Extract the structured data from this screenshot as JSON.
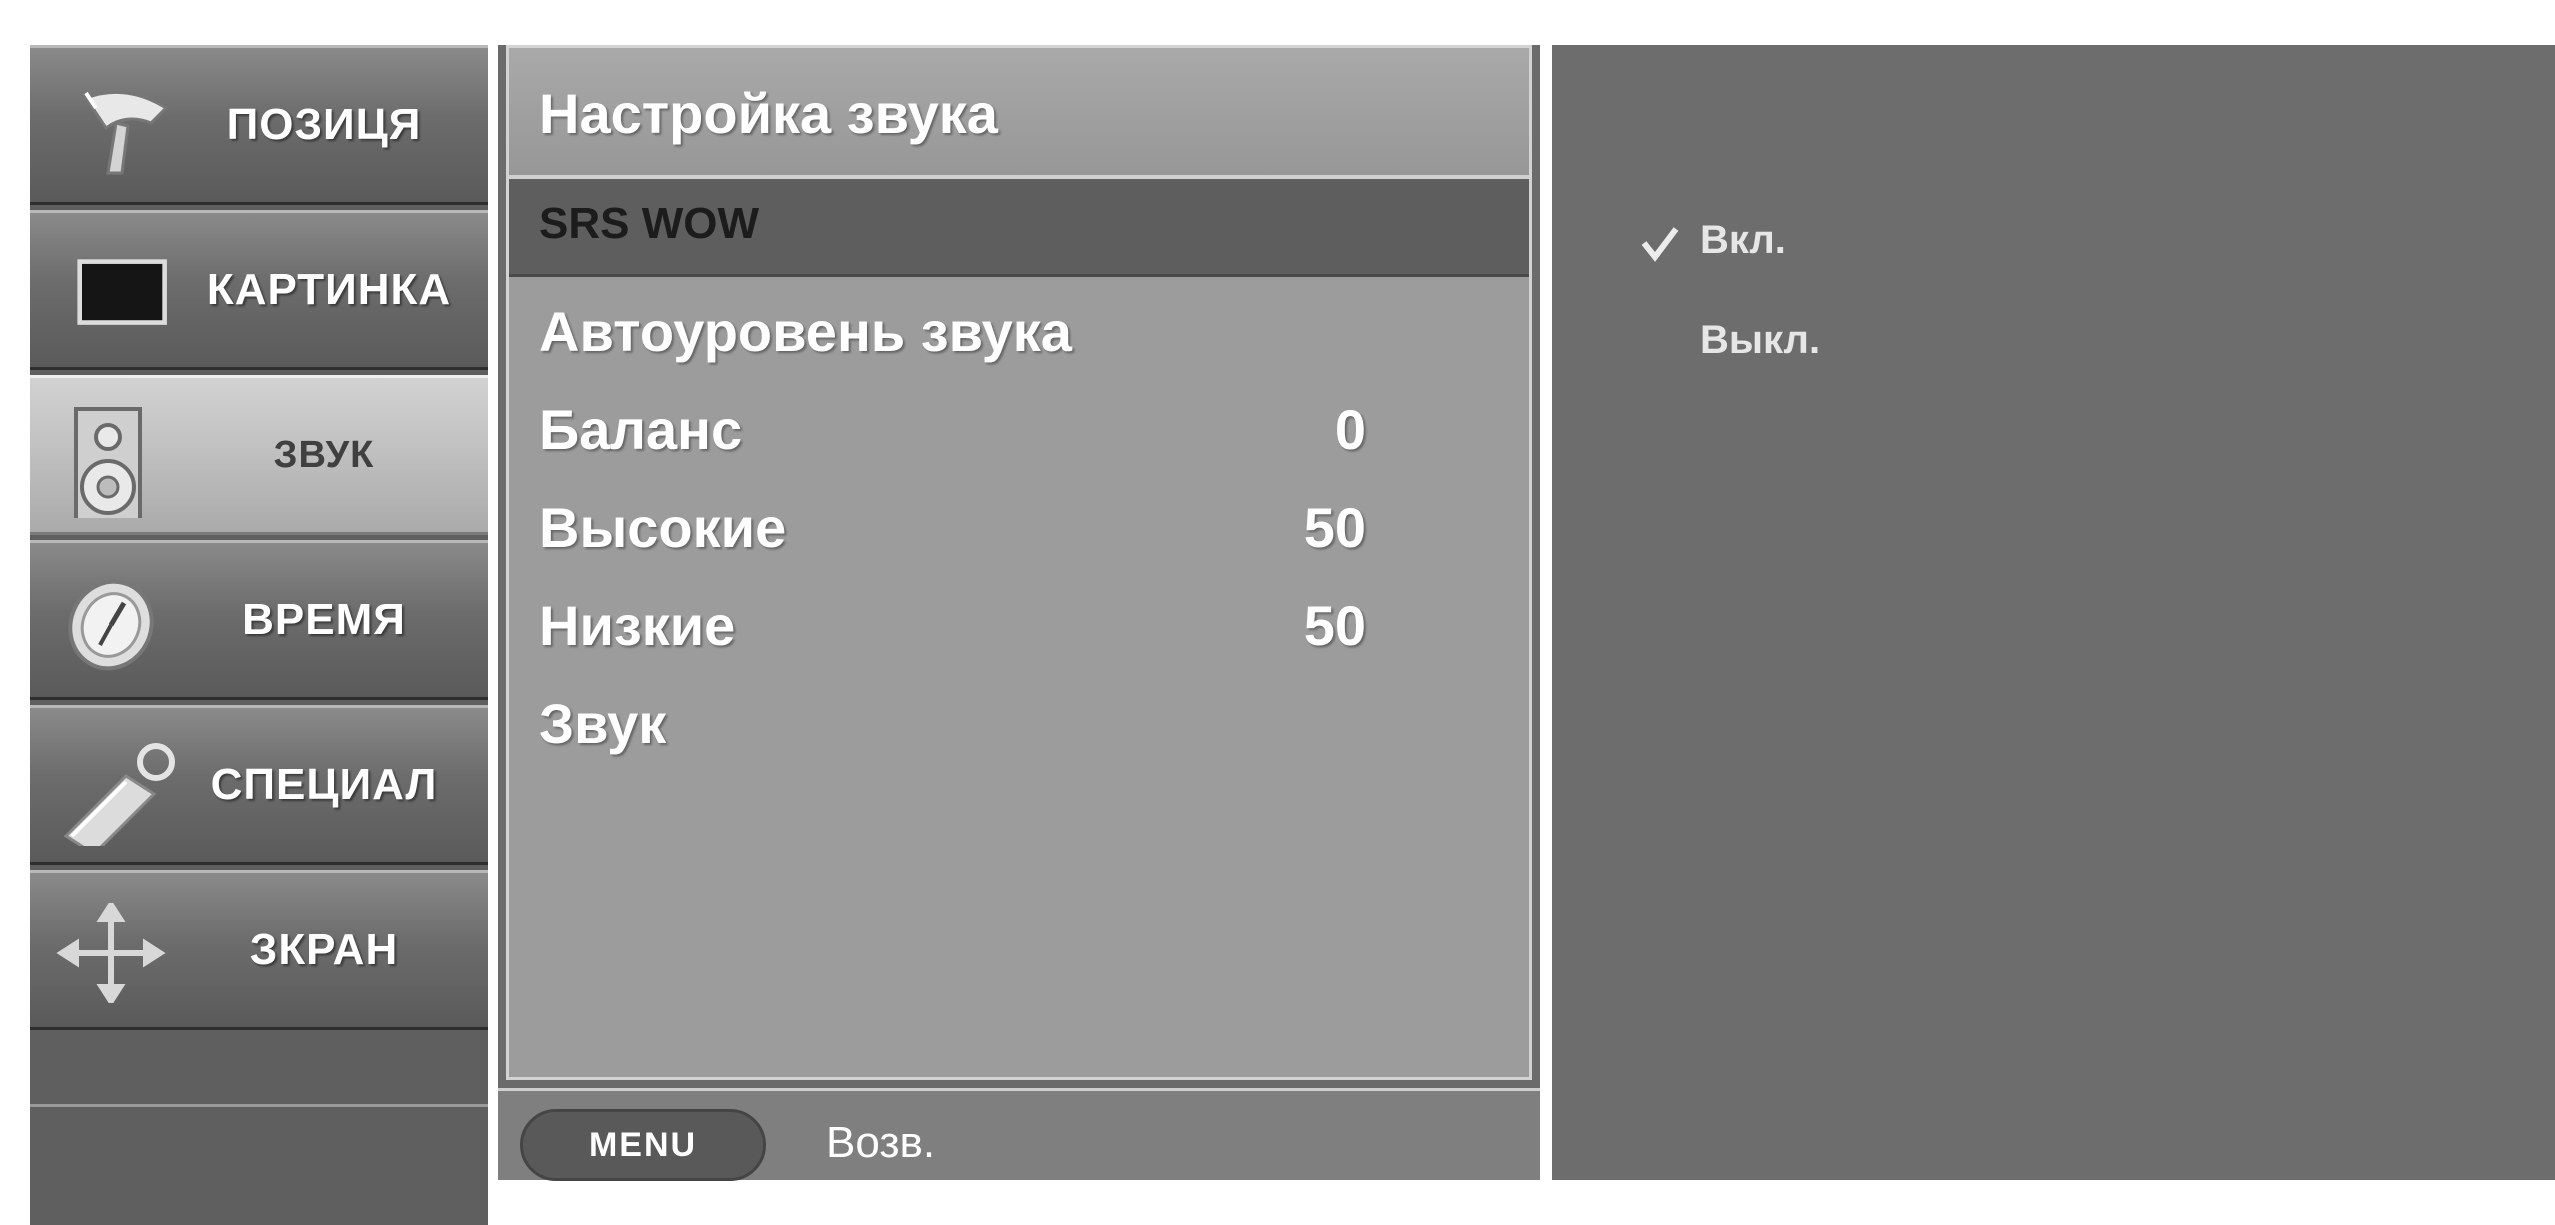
{
  "sidebar": {
    "items": [
      {
        "label": "ПОЗИЦЯ",
        "icon": "satellite-dish-icon",
        "active": false
      },
      {
        "label": "КАРТИНКА",
        "icon": "tv-screen-icon",
        "active": false
      },
      {
        "label": "ЗВУК",
        "icon": "speaker-icon",
        "active": true
      },
      {
        "label": "ВРЕМЯ",
        "icon": "clock-icon",
        "active": false
      },
      {
        "label": "СПЕЦИАЛ",
        "icon": "key-tag-icon",
        "active": false
      },
      {
        "label": "ЗКРАН",
        "icon": "move-arrows-icon",
        "active": false
      }
    ]
  },
  "menu": {
    "title": "Настройка звука",
    "items": [
      {
        "label": "SRS WOW",
        "value": "",
        "selected": true
      },
      {
        "label": "Автоуровень звука",
        "value": ""
      },
      {
        "label": "Баланс",
        "value": "0"
      },
      {
        "label": "Высокие",
        "value": "50"
      },
      {
        "label": "Низкие",
        "value": "50"
      },
      {
        "label": "Звук",
        "value": ""
      }
    ],
    "footer": {
      "menu_button": "MENU",
      "back_label": "Возв."
    }
  },
  "options": {
    "items": [
      {
        "label": "Вкл.",
        "checked": true
      },
      {
        "label": "Выкл.",
        "checked": false
      }
    ]
  },
  "colors": {
    "panel_dark": "#6d6d6d",
    "panel_mid": "#9c9c9c",
    "selected_row": "#5e5e5e",
    "active_tab": "#bdbdbd"
  }
}
